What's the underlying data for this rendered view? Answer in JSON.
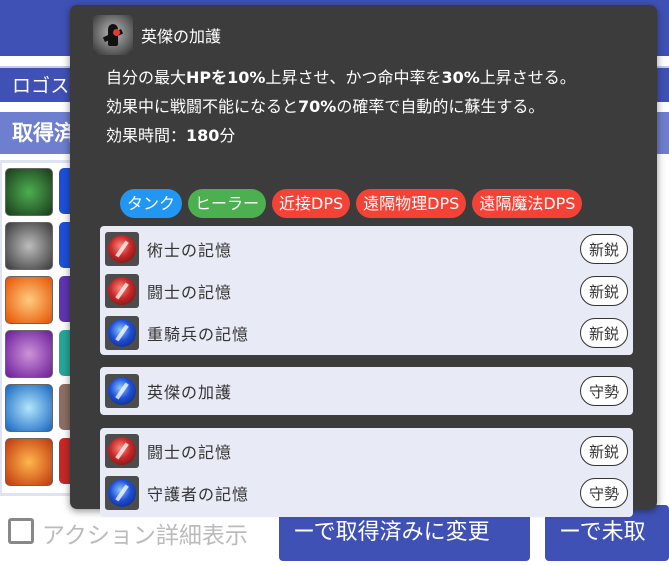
{
  "background": {
    "logo_bar_text": "ロゴス",
    "section_title": "取得済",
    "checkbox_label": "アクション詳細表示",
    "button_left_label": "ーで取得済みに変更",
    "button_right_label": "ーで未取"
  },
  "tooltip": {
    "title": "英傑の加護",
    "icon": "hero-figure-icon",
    "desc_parts": {
      "p1a": "自分の最大",
      "p1b": "HPを10%",
      "p1c": "上昇させ、かつ命中率を",
      "p1d": "30%",
      "p1e": "上昇させる。",
      "p2a": "効果中に戦闘不能になると",
      "p2b": "70%",
      "p2c": "の確率で自動的に蘇生する。",
      "p3a": "効果時間：",
      "p3b": "180",
      "p3c": "分"
    },
    "roles": [
      {
        "label": "タンク",
        "color": "#2196f3"
      },
      {
        "label": "ヒーラー",
        "color": "#4caf50"
      },
      {
        "label": "近接DPS",
        "color": "#f44336"
      },
      {
        "label": "遠隔物理DPS",
        "color": "#f44336"
      },
      {
        "label": "遠隔魔法DPS",
        "color": "#f44336"
      }
    ],
    "groups": [
      {
        "rows": [
          {
            "name": "術士の記憶",
            "orb": "red",
            "badge": "新鋭"
          },
          {
            "name": "闘士の記憶",
            "orb": "red",
            "badge": "新鋭"
          },
          {
            "name": "重騎兵の記憶",
            "orb": "blue",
            "badge": "新鋭"
          }
        ]
      },
      {
        "rows": [
          {
            "name": "英傑の加護",
            "orb": "blue",
            "badge": "守勢"
          }
        ]
      },
      {
        "rows": [
          {
            "name": "闘士の記憶",
            "orb": "red",
            "badge": "新鋭"
          },
          {
            "name": "守護者の記憶",
            "orb": "blue",
            "badge": "守勢"
          }
        ]
      }
    ]
  }
}
